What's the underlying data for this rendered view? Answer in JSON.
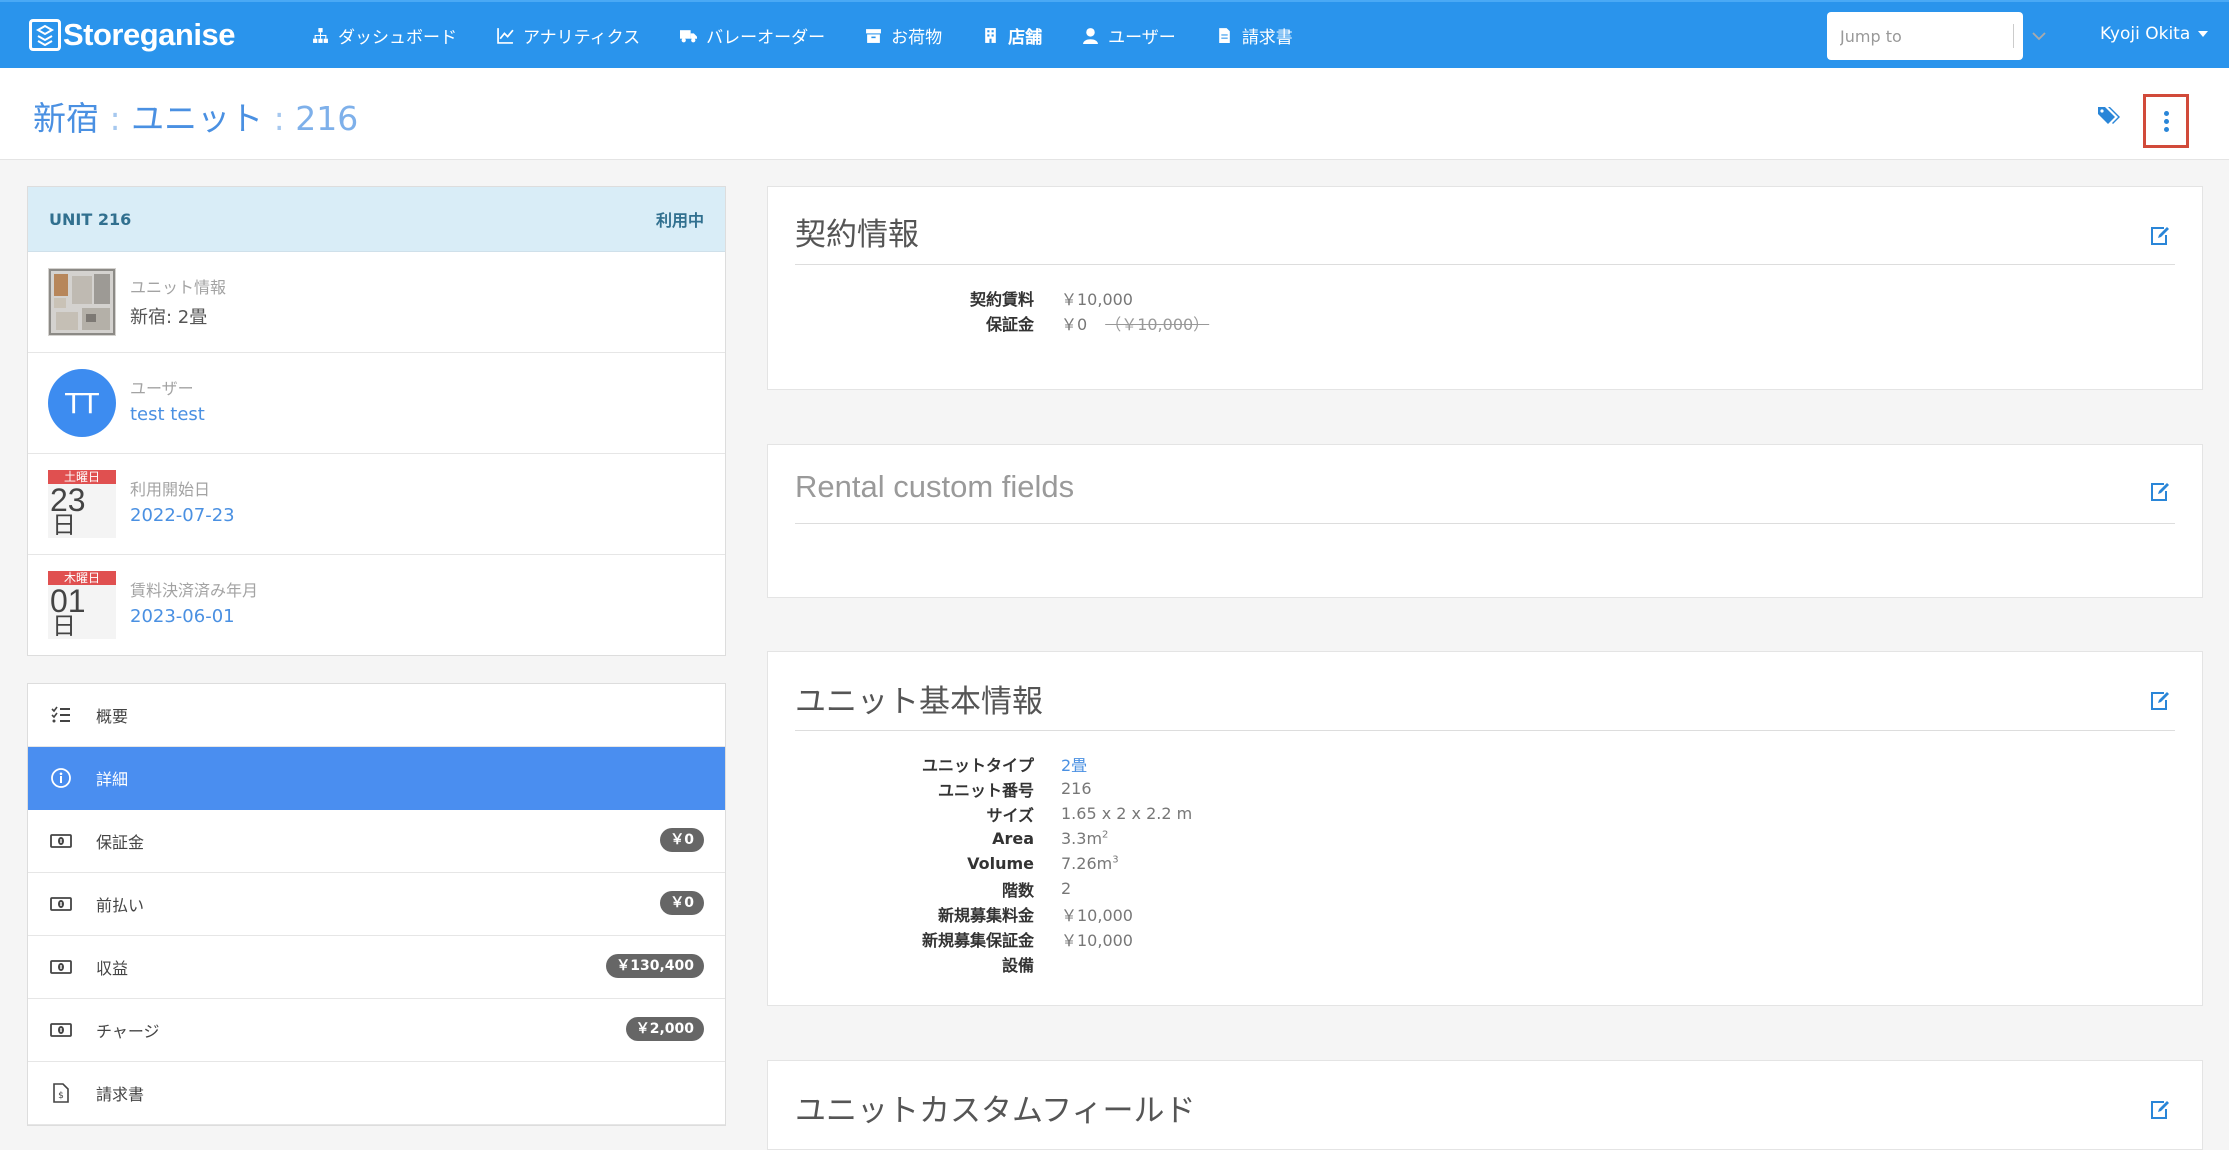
{
  "navbar": {
    "brand": "Storeganise",
    "menu": [
      {
        "label": "ダッシュボード",
        "icon": "sitemap-icon"
      },
      {
        "label": "アナリティクス",
        "icon": "line-chart-icon"
      },
      {
        "label": "バレーオーダー",
        "icon": "truck-icon"
      },
      {
        "label": "お荷物",
        "icon": "archive-icon"
      },
      {
        "label": "店舗",
        "icon": "building-icon"
      },
      {
        "label": "ユーザー",
        "icon": "user-icon"
      },
      {
        "label": "請求書",
        "icon": "file-icon"
      }
    ],
    "jump_placeholder": "Jump to",
    "user_name": "Kyoji Okita"
  },
  "title": {
    "site": "新宿",
    "sep1": " : ",
    "section": "ユニット",
    "sep2": " : ",
    "unit_number": "216"
  },
  "unit_panel": {
    "header_left": "UNIT 216",
    "header_right": "利用中",
    "rows": [
      {
        "label": "ユニット情報",
        "value": "新宿: 2畳"
      },
      {
        "label": "ユーザー",
        "value": "test test",
        "avatar": "TT"
      },
      {
        "label": "利用開始日",
        "value": "2022-07-23",
        "cal_weekday": "土曜日",
        "cal_day": "23",
        "cal_suffix": "日"
      },
      {
        "label": "賃料決済済み年月",
        "value": "2023-06-01",
        "cal_weekday": "木曜日",
        "cal_day": "01",
        "cal_suffix": "日"
      }
    ]
  },
  "side_menu": [
    {
      "label": "概要",
      "icon": "list-check-icon",
      "badge": ""
    },
    {
      "label": "詳細",
      "icon": "info-circle-icon",
      "badge": ""
    },
    {
      "label": "保証金",
      "icon": "money-bill-icon",
      "badge": "￥0"
    },
    {
      "label": "前払い",
      "icon": "money-bill-icon",
      "badge": "￥0"
    },
    {
      "label": "収益",
      "icon": "money-bill-icon",
      "badge": "￥130,400"
    },
    {
      "label": "チャージ",
      "icon": "money-bill-icon",
      "badge": "￥2,000"
    },
    {
      "label": "請求書",
      "icon": "invoice-icon",
      "badge": ""
    }
  ],
  "cards": {
    "contract": {
      "title": "契約情報",
      "rows": [
        {
          "label": "契約賃料",
          "value": "￥10,000"
        },
        {
          "label": "保証金",
          "value": "￥0",
          "strike": "（￥10,000）"
        }
      ]
    },
    "rental_custom": {
      "title": "Rental custom fields"
    },
    "unit_basic": {
      "title": "ユニット基本情報",
      "rows": [
        {
          "label": "ユニットタイプ",
          "value": "2畳"
        },
        {
          "label": "ユニット番号",
          "value": "216"
        },
        {
          "label": "サイズ",
          "value": "1.65 x 2 x 2.2 m"
        },
        {
          "label": "Area",
          "value": "3.3m",
          "sup": "2"
        },
        {
          "label": "Volume",
          "value": "7.26m",
          "sup": "3"
        },
        {
          "label": "階数",
          "value": "2"
        },
        {
          "label": "新規募集料金",
          "value": "￥10,000"
        },
        {
          "label": "新規募集保証金",
          "value": "￥10,000"
        },
        {
          "label": "設備",
          "value": ""
        }
      ]
    },
    "unit_custom": {
      "title": "ユニットカスタムフィールド"
    }
  },
  "colors": {
    "navbar": "#2a94ec",
    "link": "#4a90e2",
    "active_menu": "#4a8ef0",
    "header_info": "#d9edf7",
    "highlight_border": "#d14a3a"
  }
}
